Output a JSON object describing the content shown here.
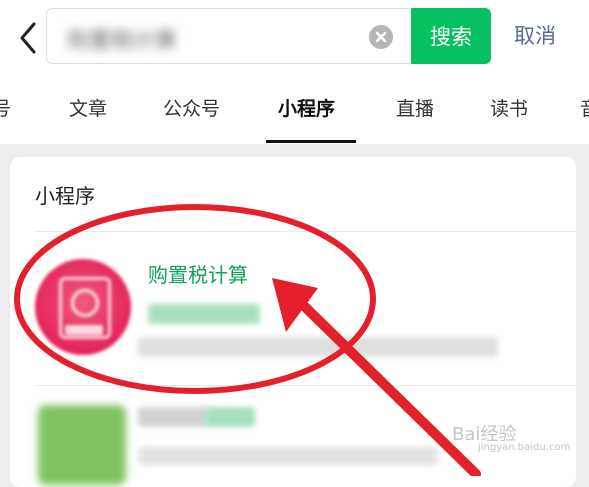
{
  "search": {
    "query": "购置税计算",
    "button_label": "搜索",
    "cancel_label": "取消"
  },
  "tabs": [
    {
      "label": "号"
    },
    {
      "label": "文章"
    },
    {
      "label": "公众号"
    },
    {
      "label": "小程序",
      "active": true
    },
    {
      "label": "直播"
    },
    {
      "label": "读书"
    },
    {
      "label": "音"
    }
  ],
  "results": {
    "section_title": "小程序",
    "items": [
      {
        "name": "购置税计算",
        "icon": "mini-program-icon"
      }
    ]
  },
  "annotation": {
    "shapes": [
      "red-ellipse",
      "red-arrow"
    ],
    "color": "#e3202b"
  },
  "colors": {
    "accent": "#07c160",
    "link": "#576b95",
    "result_title": "#12a05a"
  },
  "watermark": {
    "text": "Bai经验",
    "sub": "jingyan.baidu.com"
  }
}
